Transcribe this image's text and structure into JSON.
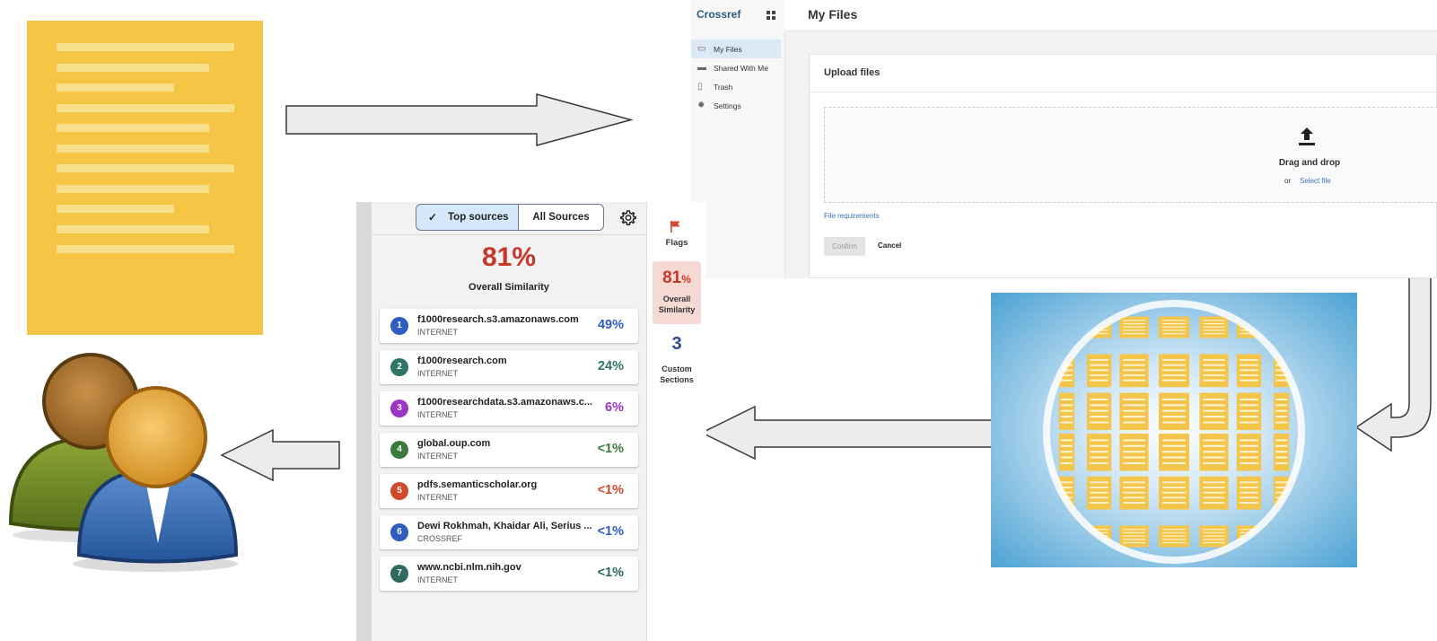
{
  "crossref": {
    "brand": "Crossref",
    "title": "My Files",
    "nav": [
      {
        "label": "My Files",
        "icon": "my-files-icon",
        "active": true
      },
      {
        "label": "Shared With Me",
        "icon": "shared-icon",
        "active": false
      },
      {
        "label": "Trash",
        "icon": "trash-icon",
        "active": false
      },
      {
        "label": "Settings",
        "icon": "settings-icon",
        "active": false
      }
    ],
    "upload_title": "Upload files",
    "drag_drop": "Drag and drop",
    "or": "or",
    "select_file": "Select file",
    "file_requirements": "File requirements",
    "confirm": "Confirm",
    "cancel": "Cancel"
  },
  "similarity": {
    "tabs": {
      "top": "Top sources",
      "all": "All Sources"
    },
    "overall_pct": "81%",
    "overall_label": "Overall Similarity",
    "sources": [
      {
        "num": "1",
        "name": "f1000research.s3.amazonaws.com",
        "type": "INTERNET",
        "pct": "49%",
        "color": "#2f5ec0"
      },
      {
        "num": "2",
        "name": "f1000research.com",
        "type": "INTERNET",
        "pct": "24%",
        "color": "#2e7466"
      },
      {
        "num": "3",
        "name": "f1000researchdata.s3.amazonaws.c...",
        "type": "INTERNET",
        "pct": "6%",
        "color": "#9a35c4"
      },
      {
        "num": "4",
        "name": "global.oup.com",
        "type": "INTERNET",
        "pct": "<1%",
        "color": "#3a7a3a"
      },
      {
        "num": "5",
        "name": "pdfs.semanticscholar.org",
        "type": "INTERNET",
        "pct": "<1%",
        "color": "#d1492a"
      },
      {
        "num": "6",
        "name": "Dewi Rokhmah, Khaidar Ali, Serius ...",
        "type": "CROSSREF",
        "pct": "<1%",
        "color": "#2f5ec0"
      },
      {
        "num": "7",
        "name": "www.ncbi.nlm.nih.gov",
        "type": "INTERNET",
        "pct": "<1%",
        "color": "#2e6a5e"
      }
    ],
    "rail": {
      "flags_label": "Flags",
      "sim_pct": "81",
      "sim_pct_sign": "%",
      "sim_label": "Overall Similarity",
      "custom_num": "3",
      "custom_label": "Custom Sections"
    }
  }
}
